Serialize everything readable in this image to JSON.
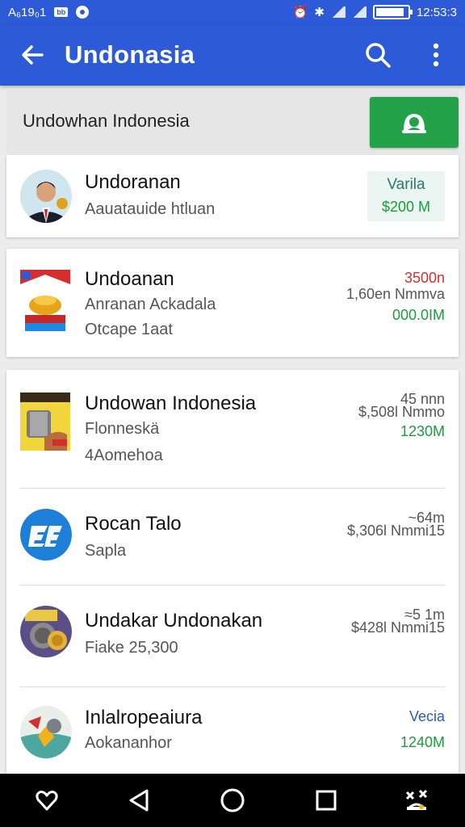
{
  "status_bar": {
    "left_text": "A₆19₀1",
    "chip": "bb",
    "time": "12:53:3"
  },
  "app_bar": {
    "title": "Undonasia"
  },
  "header": {
    "text": "Undowhan Indonesia"
  },
  "items": [
    {
      "name": "Undoranan",
      "sub1": "Aauatauide htluan",
      "badge_label": "Varila",
      "badge_value": "$200 M"
    },
    {
      "name": "Undoanan",
      "sub1": "Anranan Ackadala",
      "sub2": "Otcape 1aat",
      "price_top": "3500n",
      "price_mid": "1,60en Nmmva",
      "price_bot": "000.0IM"
    },
    {
      "name": "Undowan Indonesia",
      "sub1": "Flonneskä",
      "sub2": "4Aomehoa",
      "price_top": "45 nnn",
      "price_mid": "$,508l Nmmo",
      "price_bot": "1230M"
    },
    {
      "name": "Rocan Talo",
      "sub1": "Sapla",
      "price_top": "~64m",
      "price_mid": "$,306l Nmmi15"
    },
    {
      "name": "Undakar Undonakan",
      "sub1": "Fiake 25,300",
      "price_top": "≈5 1m",
      "price_mid": "$428l Nmmi15"
    },
    {
      "name": "Inlalropeaiura",
      "sub1": "Aokananhor",
      "price_top": "Vecia",
      "price_bot": "1240M"
    }
  ],
  "colors": {
    "primary": "#2d5ad6",
    "action_green": "#23a24a",
    "price_green": "#1f9a3d",
    "price_red": "#d32f2f"
  }
}
